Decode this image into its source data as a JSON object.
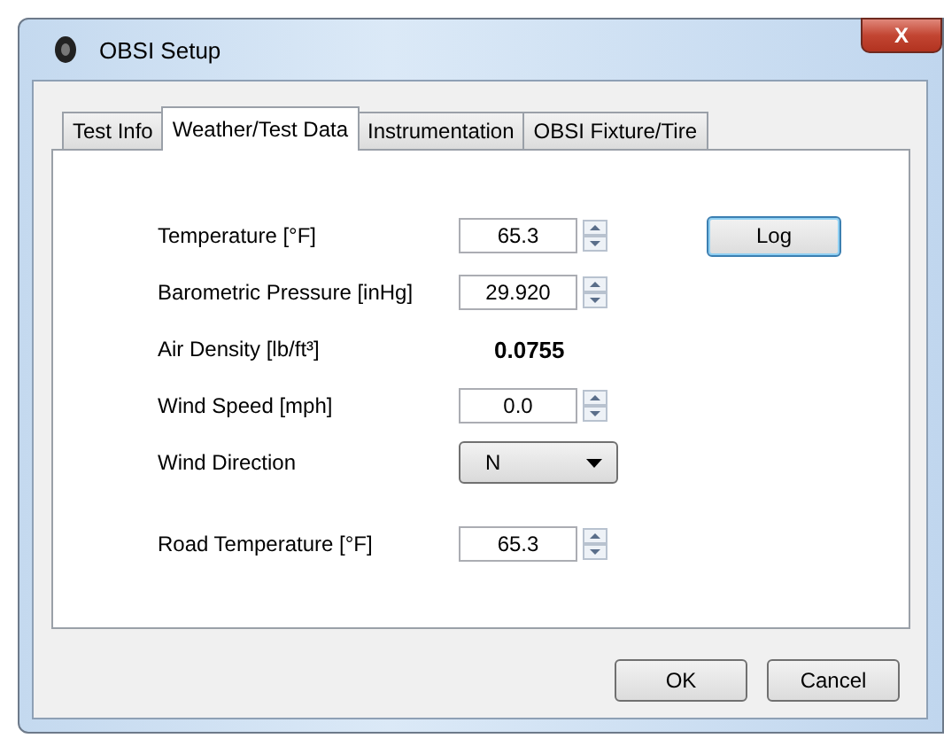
{
  "window": {
    "title": "OBSI Setup",
    "close": "X"
  },
  "tabs": [
    {
      "label": "Test Info",
      "selected": false
    },
    {
      "label": "Weather/Test Data",
      "selected": true
    },
    {
      "label": "Instrumentation",
      "selected": false
    },
    {
      "label": "OBSI Fixture/Tire",
      "selected": false
    }
  ],
  "log_button": "Log",
  "weather_fields": [
    {
      "kind": "spin",
      "label": "Temperature [°F]",
      "value": "65.3"
    },
    {
      "kind": "spin",
      "label": "Barometric Pressure [inHg]",
      "value": "29.920"
    },
    {
      "kind": "display",
      "label": "Air Density [lb/ft³]",
      "value": "0.0755"
    },
    {
      "kind": "spin",
      "label": "Wind Speed [mph]",
      "value": "0.0"
    },
    {
      "kind": "dropdown",
      "label": "Wind Direction",
      "value": "N"
    }
  ],
  "road_fields": [
    {
      "kind": "spin",
      "label": "Road Temperature [°F]",
      "value": "65.3"
    }
  ],
  "buttons": [
    "OK",
    "Cancel"
  ]
}
